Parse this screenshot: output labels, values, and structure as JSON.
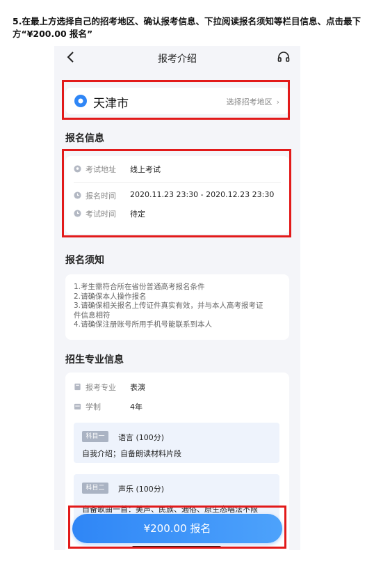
{
  "instruction": "5.在最上方选择自己的招考地区、确认报考信息、下拉阅读报名须知等栏目信息、点击最下方“¥200.00 报名”",
  "nav": {
    "title": "报考介绍"
  },
  "region": {
    "city": "天津市",
    "select_label": "选择招考地区",
    "chevron": "›"
  },
  "registration_info": {
    "title": "报名信息",
    "rows": [
      {
        "icon": "location-icon",
        "label": "考试地址",
        "value": "线上考试"
      },
      {
        "icon": "clock-icon",
        "label": "报名时间",
        "value": "2020.11.23 23:30 - 2020.12.23 23:30"
      },
      {
        "icon": "clock-icon",
        "label": "考试时间",
        "value": "待定"
      }
    ]
  },
  "notice": {
    "title": "报名须知",
    "lines": [
      "1.考生需符合所在省份普通高考报名条件",
      "2.请确保本人操作报名",
      "3.请确保相关报名上传证件真实有效，并与本人高考报考证\n件信息相符",
      "4.请确保注册账号所用手机号能联系到本人"
    ]
  },
  "major_info": {
    "title": "招生专业信息",
    "major_label": "报考专业",
    "major_value": "表演",
    "duration_label": "学制",
    "duration_value": "4年",
    "subjects": [
      {
        "tag": "科目一",
        "name": "语言 (100分)",
        "desc": "自我介绍；自备朗读材料片段"
      },
      {
        "tag": "科目二",
        "name": "声乐 (100分)",
        "desc": "自备歌曲一首：美声、民族、通俗、原生态唱法不限"
      }
    ]
  },
  "signup_button": "¥200.00 报名",
  "colors": {
    "accent": "#2f86f6",
    "highlight": "#e21a1a",
    "background": "#f4f5f9"
  }
}
